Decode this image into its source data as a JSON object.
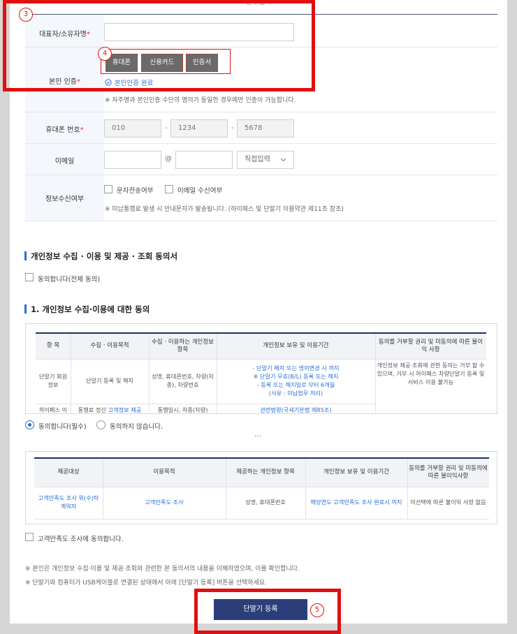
{
  "form": {
    "top_title": "필수입력",
    "owner": {
      "label": "대표자/소유자명",
      "req": "*"
    },
    "auth": {
      "label": "본인 인증",
      "req": "*",
      "buttons": [
        "휴대폰",
        "신용카드",
        "인증서"
      ],
      "done": "본인인증 완료",
      "note": "※ 차주명과 본인인증 수단의 명의가 동일한 경우에만 인증이 가능합니다."
    },
    "phone": {
      "label": "휴대폰 번호",
      "req": "*",
      "p1": "010",
      "p2": "1234",
      "p3": "5678",
      "dash": "-"
    },
    "email": {
      "label": "이메일",
      "at": "@",
      "select": "직접입력"
    },
    "receive": {
      "label": "정보수신여부",
      "opt1": "문자전송여부",
      "opt2": "이메일 수신여부",
      "note": "※ 미납통행료 발생 시 안내문자가 발송됩니다. (하이패스 및 단말기 이용약관 제11조 참조)"
    }
  },
  "consent": {
    "title": "개인정보 수집 · 이용 및 제공 · 조회 동의서",
    "all_agree": "동의합니다(전체 동의)",
    "sec1_title": "1. 개인정보 수집·이용에 대한 동의",
    "t1": {
      "headers": [
        "항 목",
        "수집 · 이용목적",
        "수집 · 이용하는 개인정보 항목",
        "개인정보 보유 및 이용기간",
        "동의를 거부할 권리 및 미동의에 따른 불이익 사항"
      ],
      "r1c1": "단말기 회원 정보",
      "r1c2": "단말기 등록 및 해지",
      "r1c3": "성명, 휴대폰번호, 차량(차종), 차량번호",
      "r1c4a": "- 단말기 해지 또는 명의변경 시 까지",
      "r1c4b": "※ 단말기 무효(B/L) 등록 또는 해지",
      "r1c4c": "- 등록 또는 해지일로 부터 6개월",
      "r1c4d": "(사유 : 미납업무 처리)",
      "r1c5": "개인정보 제공·조회에 관한 동의는 거부 할 수 있으며, 거부 시 하이패스 차량단말기 등록 및 서비스 이용 불가능",
      "r2c1": "하이패스 이",
      "r2c2": "통행료 정산",
      "r2c2b": "고객정보 제공",
      "r2c3": "통행일시, 차종(차량)",
      "r2c4": "관련법령(국세기본법 제85조)"
    },
    "agree": "동의합니다(필수)",
    "disagree": "동의하지 않습니다.",
    "ellipsis": "...",
    "t2": {
      "headers": [
        "제공대상",
        "이용목적",
        "제공하는 개인정보 항목",
        "개인정보 보유 및 이용기간",
        "동의를 거부할 권리 및 미동의에 따른 불이익사항"
      ],
      "c1": "고객만족도 조사 위(수)탁 계약자",
      "c2": "고객만족도 조사",
      "c3": "성명, 휴대폰번호",
      "c4": "해당연도 고객만족도 조사 완료시 까지",
      "c5": "미선택에 따른 불이익 사항 없음"
    },
    "survey_agree": "고객만족도 조사에 동의합니다.",
    "note1": "※ 본인은 개인정보 수집·이용 및 제공·조회와 관련한 본 동의서의 내용을 이해하였으며, 이를 확인합니다.",
    "note2": "※ 단말기와 컴퓨터가 USB케이블로 연결된 상태에서 아래 [단말기 등록] 버튼을 선택하세요."
  },
  "register_button": "단말기 등록",
  "annotations": {
    "b3": "3",
    "b4": "4",
    "b5": "5"
  },
  "colors": {
    "accent": "#2a6fd6",
    "primary_button": "#2c3e7a",
    "annotation": "#e01010"
  },
  "icons": {
    "done": "check-circle-icon",
    "select": "chevron-down-icon"
  }
}
